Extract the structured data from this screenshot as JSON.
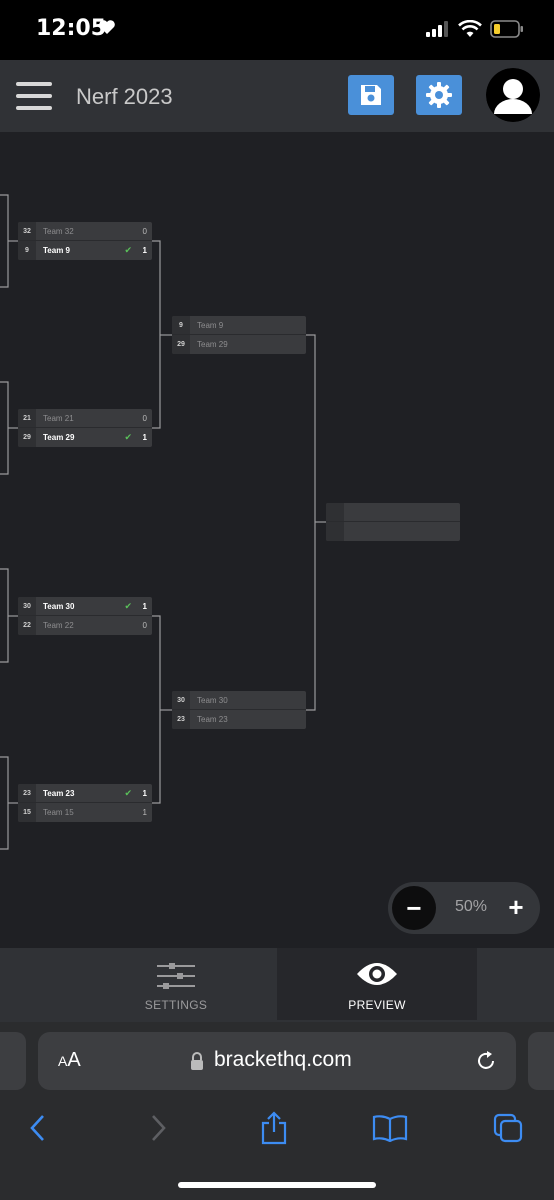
{
  "status": {
    "time": "12:05"
  },
  "header": {
    "title": "Nerf 2023"
  },
  "round1": [
    {
      "rows": [
        {
          "seed": "32",
          "team": "Team 32",
          "score": "0",
          "win": false
        },
        {
          "seed": "9",
          "team": "Team 9",
          "score": "1",
          "win": true
        }
      ]
    },
    {
      "rows": [
        {
          "seed": "21",
          "team": "Team 21",
          "score": "0",
          "win": false
        },
        {
          "seed": "29",
          "team": "Team 29",
          "score": "1",
          "win": true
        }
      ]
    },
    {
      "rows": [
        {
          "seed": "30",
          "team": "Team 30",
          "score": "1",
          "win": true
        },
        {
          "seed": "22",
          "team": "Team 22",
          "score": "0",
          "win": false
        }
      ]
    },
    {
      "rows": [
        {
          "seed": "23",
          "team": "Team 23",
          "score": "1",
          "win": true
        },
        {
          "seed": "15",
          "team": "Team 15",
          "score": "1",
          "win": false
        }
      ]
    }
  ],
  "round2": [
    {
      "rows": [
        {
          "seed": "9",
          "team": "Team 9",
          "score": "",
          "win": false
        },
        {
          "seed": "29",
          "team": "Team 29",
          "score": "",
          "win": false
        }
      ]
    },
    {
      "rows": [
        {
          "seed": "30",
          "team": "Team 30",
          "score": "",
          "win": false
        },
        {
          "seed": "23",
          "team": "Team 23",
          "score": "",
          "win": false
        }
      ]
    }
  ],
  "zoom": {
    "level": "50%",
    "minus": "−",
    "plus": "+"
  },
  "tabs": {
    "settings": "SETTINGS",
    "preview": "PREVIEW"
  },
  "browser": {
    "aa_small": "A",
    "aa_big": "A",
    "url": "brackethq.com"
  }
}
